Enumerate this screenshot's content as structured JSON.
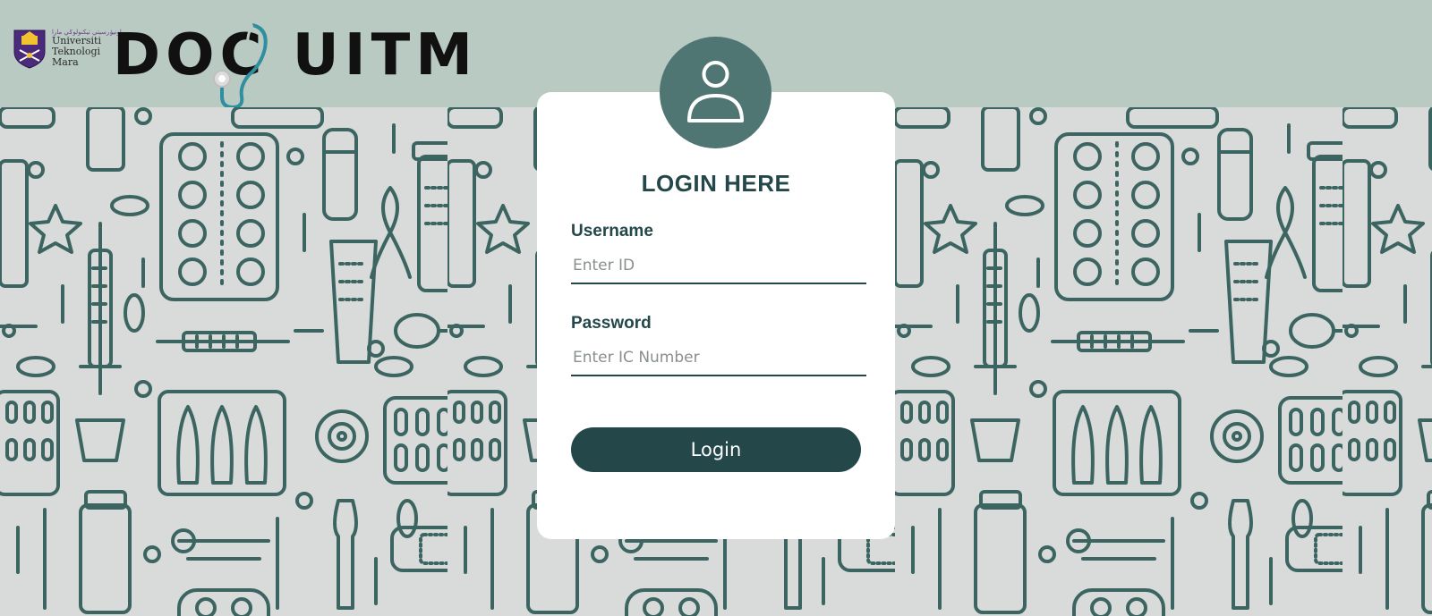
{
  "header": {
    "university_arabic": "اونيۏرسيتي تيكنولوݢي مارا",
    "university_lines": [
      "Universiti",
      "Teknologi",
      "Mara"
    ],
    "brand_left": "DOC",
    "brand_right": "UITM"
  },
  "login": {
    "title": "LOGIN HERE",
    "username_label": "Username",
    "username_placeholder": "Enter ID",
    "password_label": "Password",
    "password_placeholder": "Enter IC Number",
    "button_label": "Login"
  },
  "colors": {
    "header_bg": "#b9cac3",
    "accent_dark": "#24484a",
    "avatar_bg": "#4f7673",
    "pattern_stroke": "#3c6561",
    "pattern_bg": "#d8dbd9"
  }
}
